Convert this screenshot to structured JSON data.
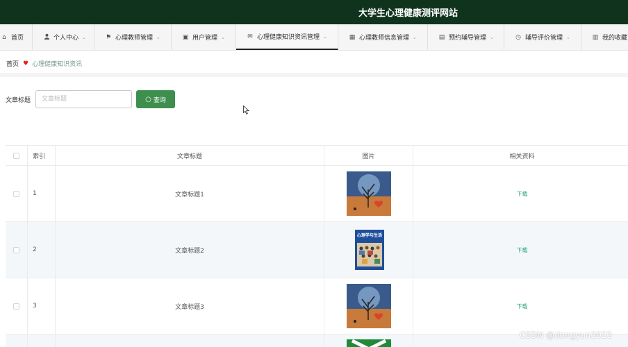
{
  "header": {
    "site_title": "大学生心理健康测评网站"
  },
  "nav": {
    "items": [
      {
        "label": "首页",
        "icon": "home-icon",
        "glyph": "⌂",
        "has_dropdown": false,
        "active": false
      },
      {
        "label": "个人中心",
        "icon": "user-icon",
        "glyph": "👤",
        "has_dropdown": true,
        "active": false
      },
      {
        "label": "心理教师管理",
        "icon": "flag-icon",
        "glyph": "⚑",
        "has_dropdown": true,
        "active": false
      },
      {
        "label": "用户管理",
        "icon": "form-icon",
        "glyph": "▣",
        "has_dropdown": true,
        "active": false
      },
      {
        "label": "心理健康知识资讯管理",
        "icon": "mail-icon",
        "glyph": "✉",
        "has_dropdown": true,
        "active": true
      },
      {
        "label": "心理教师信息管理",
        "icon": "grid-icon",
        "glyph": "▦",
        "has_dropdown": true,
        "active": false
      },
      {
        "label": "预约辅导管理",
        "icon": "briefcase-icon",
        "glyph": "▤",
        "has_dropdown": true,
        "active": false
      },
      {
        "label": "辅导评价管理",
        "icon": "clock-icon",
        "glyph": "◷",
        "has_dropdown": true,
        "active": false
      },
      {
        "label": "我的收藏",
        "icon": "file-icon",
        "glyph": "▥",
        "has_dropdown": false,
        "active": false
      }
    ]
  },
  "breadcrumb": {
    "home": "首页",
    "current": "心理健康知识资讯"
  },
  "search": {
    "label": "文章标题",
    "placeholder": "文章标题",
    "value": "",
    "button_label": "查询"
  },
  "table": {
    "columns": {
      "index": "索引",
      "title": "文章标题",
      "image": "图片",
      "material": "相关资料"
    },
    "rows": [
      {
        "index": "1",
        "title": "文章标题1",
        "image": "tree-heart-illustration",
        "material": "下载"
      },
      {
        "index": "2",
        "title": "文章标题2",
        "image": "book-cover-psychology",
        "material": "下载"
      },
      {
        "index": "3",
        "title": "文章标题3",
        "image": "tree-heart-illustration",
        "material": "下载"
      }
    ]
  },
  "book_cover_title": "心理学与生活",
  "watermark": "CSDN @dongyun2022",
  "colors": {
    "header_bg": "#0f331d",
    "primary_button": "#3e8e4d",
    "link": "#2aa67a",
    "heart": "#e02020"
  }
}
